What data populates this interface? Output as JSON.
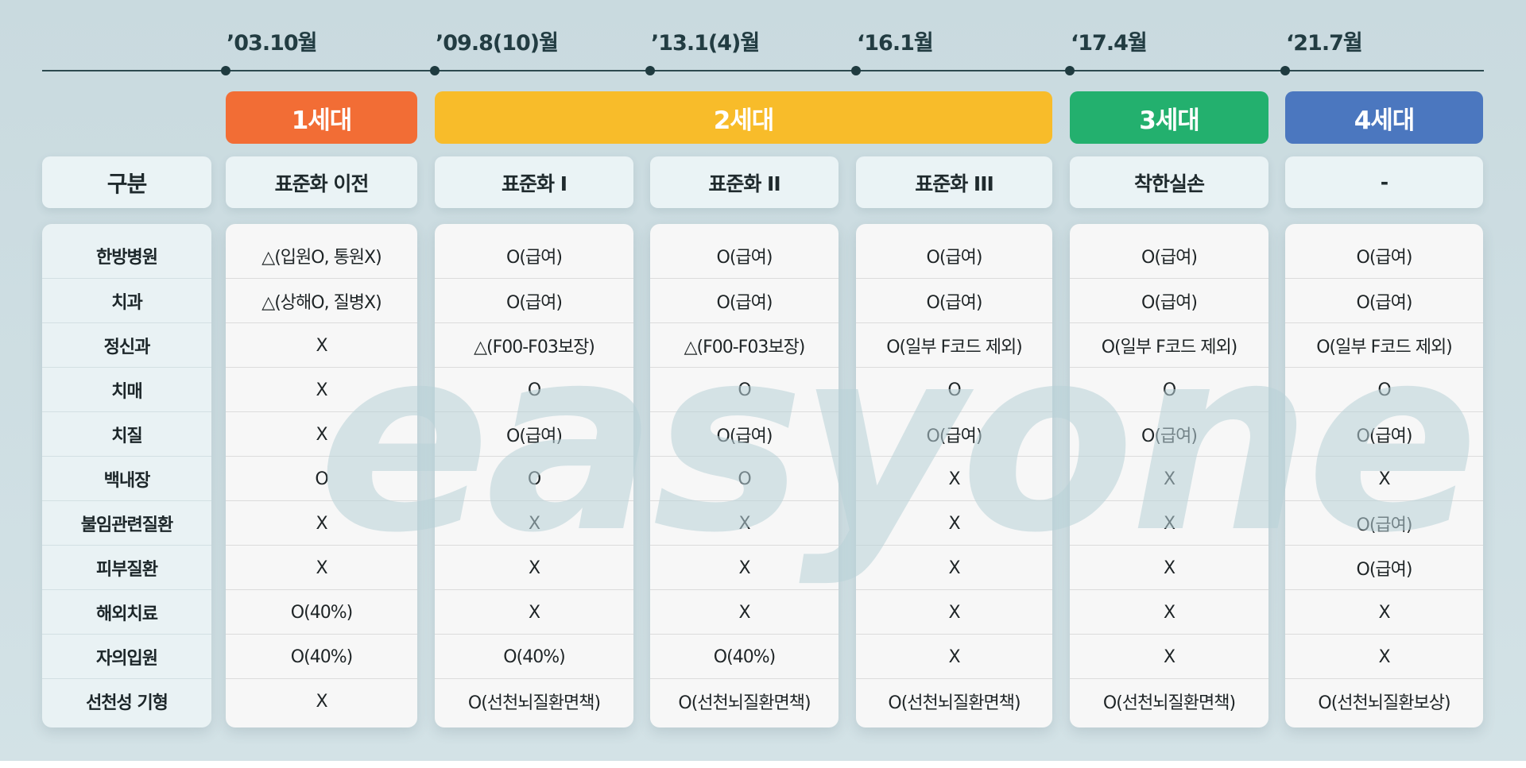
{
  "timeline": [
    "’03.10월",
    "’09.8(10)월",
    "’13.1(4)월",
    "‘16.1월",
    "‘17.4월",
    "‘21.7월"
  ],
  "generations": [
    {
      "label": "1세대",
      "color": "#f26d35"
    },
    {
      "label": "2세대",
      "color": "#f8bc2a"
    },
    {
      "label": "3세대",
      "color": "#23b06e"
    },
    {
      "label": "4세대",
      "color": "#4b77bf"
    }
  ],
  "header_label": "구분",
  "columns": [
    "표준화 이전",
    "표준화 Ⅰ",
    "표준화 II",
    "표준화 III",
    "착한실손",
    "-"
  ],
  "row_labels": [
    "한방병원",
    "치과",
    "정신과",
    "치매",
    "치질",
    "백내장",
    "불임관련질환",
    "피부질환",
    "해외치료",
    "자의입원",
    "선천성 기형"
  ],
  "cells": [
    [
      "△(입원O, 통원X)",
      "△(상해O, 질병X)",
      "X",
      "X",
      "X",
      "O",
      "X",
      "X",
      "O(40%)",
      "O(40%)",
      "X"
    ],
    [
      "O(급여)",
      "O(급여)",
      "△(F00-F03보장)",
      "O",
      "O(급여)",
      "O",
      "X",
      "X",
      "X",
      "O(40%)",
      "O(선천뇌질환면책)"
    ],
    [
      "O(급여)",
      "O(급여)",
      "△(F00-F03보장)",
      "O",
      "O(급여)",
      "O",
      "X",
      "X",
      "X",
      "O(40%)",
      "O(선천뇌질환면책)"
    ],
    [
      "O(급여)",
      "O(급여)",
      "O(일부 F코드 제외)",
      "O",
      "O(급여)",
      "X",
      "X",
      "X",
      "X",
      "X",
      "O(선천뇌질환면책)"
    ],
    [
      "O(급여)",
      "O(급여)",
      "O(일부 F코드 제외)",
      "O",
      "O(급여)",
      "X",
      "X",
      "X",
      "X",
      "X",
      "O(선천뇌질환면책)"
    ],
    [
      "O(급여)",
      "O(급여)",
      "O(일부 F코드 제외)",
      "O",
      "O(급여)",
      "X",
      "O(급여)",
      "O(급여)",
      "X",
      "X",
      "O(선천뇌질환보상)"
    ]
  ],
  "watermark": "easyone"
}
